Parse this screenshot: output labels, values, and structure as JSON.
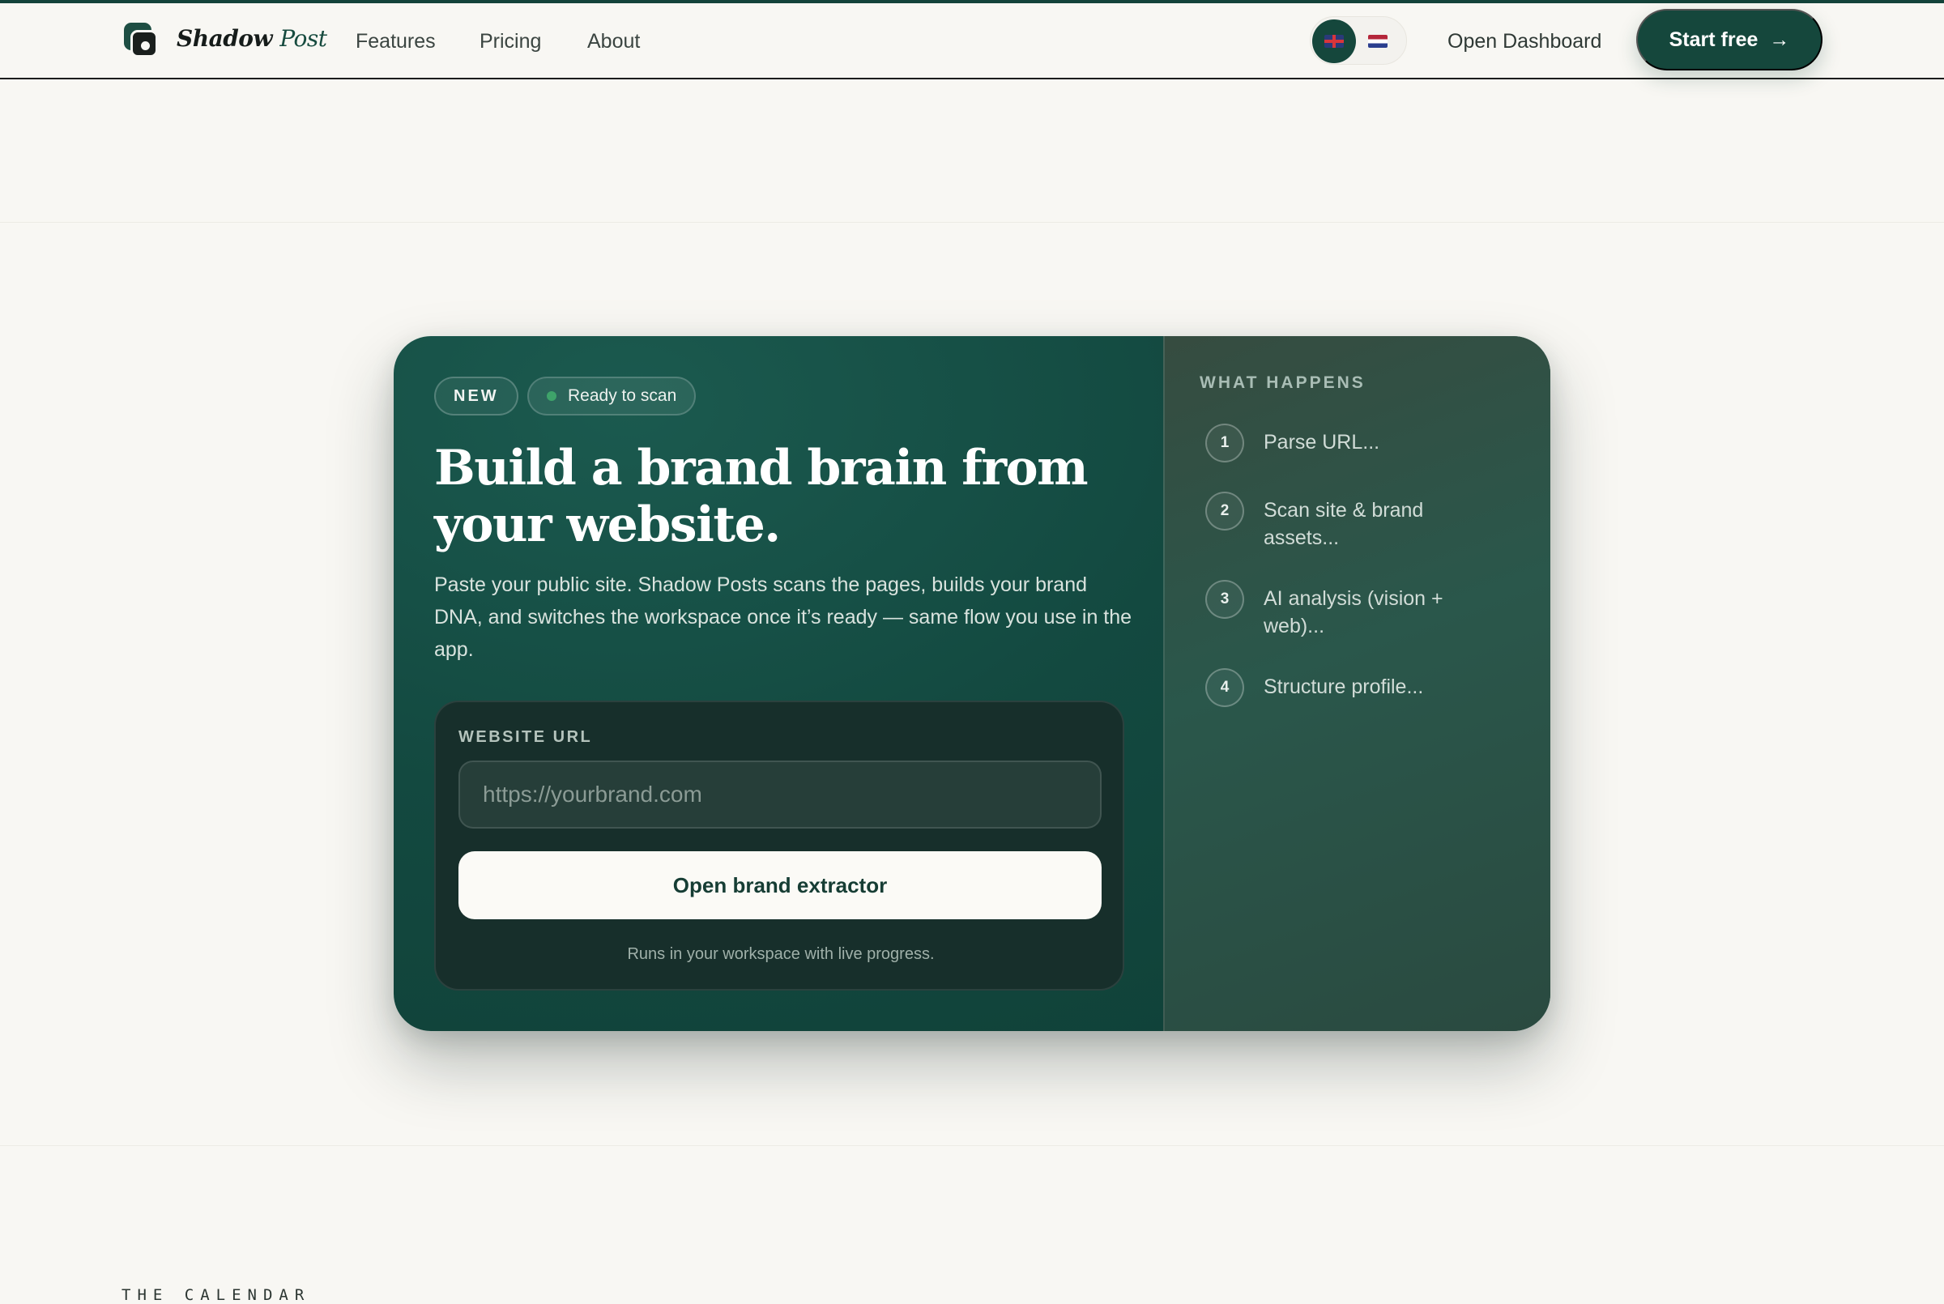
{
  "header": {
    "brand_main": "Shadow",
    "brand_accent": "Post",
    "nav": [
      "Features",
      "Pricing",
      "About"
    ],
    "languages": [
      {
        "code": "en",
        "icon": "uk-flag-icon",
        "active": true
      },
      {
        "code": "nl",
        "icon": "nl-flag-icon",
        "active": false
      }
    ],
    "open_dashboard": "Open Dashboard",
    "start_free": "Start free",
    "start_free_icon": "→"
  },
  "card": {
    "badge_new": "NEW",
    "badge_status": "Ready to scan",
    "status_color": "#3ea36a",
    "headline": "Build a brand brain from your website.",
    "description": "Paste your public site. Shadow Posts scans the pages, builds your brand DNA, and switches the workspace once it’s ready — same flow you use in the app.",
    "form": {
      "label": "WEBSITE URL",
      "placeholder": "https://yourbrand.com",
      "value": "",
      "button": "Open brand extractor",
      "note": "Runs in your workspace with live progress."
    },
    "what_happens": {
      "title": "WHAT HAPPENS",
      "steps": [
        {
          "num": "1",
          "text": "Parse URL..."
        },
        {
          "num": "2",
          "text": "Scan site & brand assets..."
        },
        {
          "num": "3",
          "text": "AI analysis (vision + web)..."
        },
        {
          "num": "4",
          "text": "Structure profile..."
        }
      ]
    }
  },
  "next_section_label": "THE CALENDAR",
  "colors": {
    "brand": "#15473c",
    "background": "#f8f7f3"
  }
}
